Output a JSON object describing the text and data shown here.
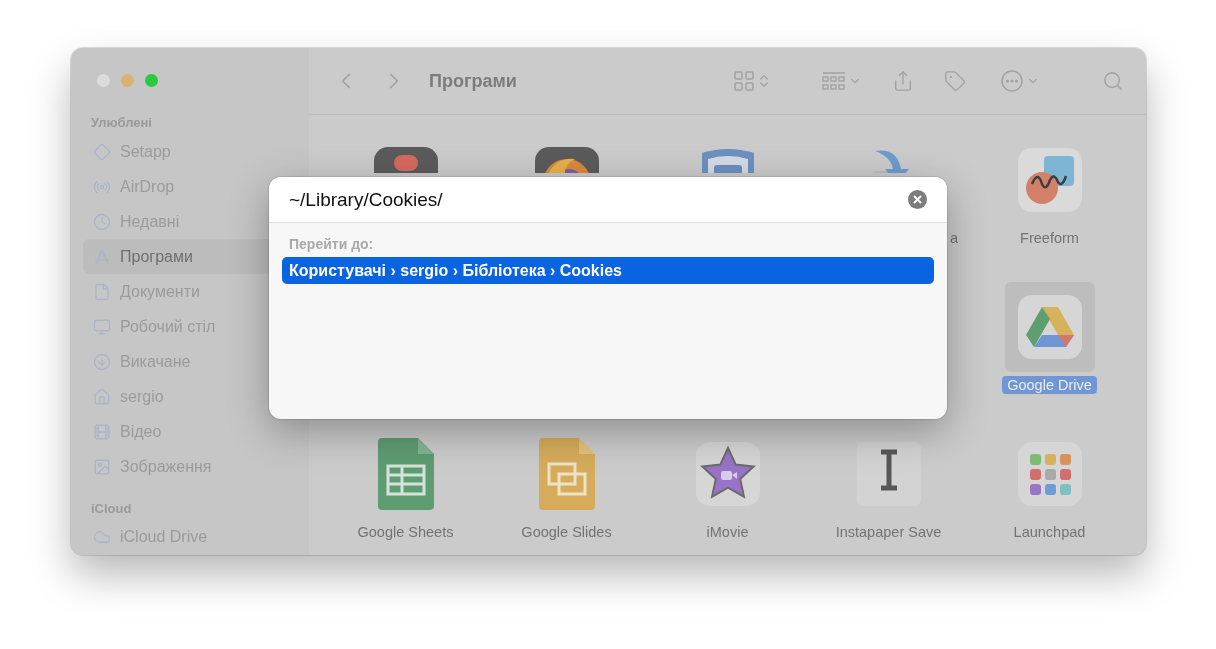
{
  "window": {
    "title": "Програми"
  },
  "sidebar": {
    "sections": [
      {
        "title": "Улюблені",
        "items": [
          {
            "label": "Setapp",
            "selected": false
          },
          {
            "label": "AirDrop",
            "selected": false
          },
          {
            "label": "Недавні",
            "selected": false
          },
          {
            "label": "Програми",
            "selected": true
          },
          {
            "label": "Документи",
            "selected": false
          },
          {
            "label": "Робочий стіл",
            "selected": false
          },
          {
            "label": "Викачане",
            "selected": false
          },
          {
            "label": "sergio",
            "selected": false
          },
          {
            "label": "Відео",
            "selected": false
          },
          {
            "label": "Зображення",
            "selected": false
          }
        ]
      },
      {
        "title": "iCloud",
        "items": [
          {
            "label": "iCloud Drive",
            "selected": false
          }
        ]
      }
    ]
  },
  "app_rows": [
    {
      "items": [
        {
          "selected": false
        },
        {
          "selected": false
        },
        {
          "selected": false
        },
        {
          "label": "a",
          "selected": false
        },
        {
          "label": "Freeform",
          "selected": false
        }
      ]
    },
    {
      "items": [
        {
          "label": "Google Drive",
          "selected": true
        }
      ]
    },
    {
      "items": [
        {
          "label": "Google Sheets",
          "selected": false
        },
        {
          "label": "Google Slides",
          "selected": false
        },
        {
          "label": "iMovie",
          "selected": false
        },
        {
          "label": "Instapaper Save",
          "selected": false
        },
        {
          "label": "Launchpad",
          "selected": false
        }
      ]
    }
  ],
  "dialog": {
    "value": "~/Library/Cookies/",
    "section_title": "Перейти до:",
    "results": [
      {
        "path": "Користувачі › sergio › Бібліотека › Cookies",
        "selected": true
      }
    ]
  }
}
